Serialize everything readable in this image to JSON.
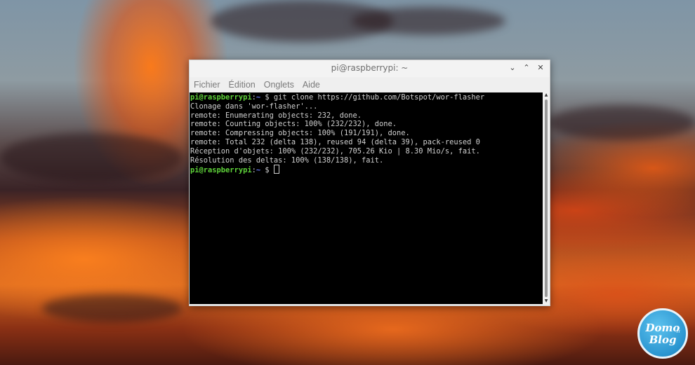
{
  "window": {
    "title": "pi@raspberrypi: ~",
    "controls": {
      "minimize": "⌄",
      "maximize": "⌃",
      "close": "✕"
    }
  },
  "menubar": {
    "items": [
      "Fichier",
      "Édition",
      "Onglets",
      "Aide"
    ]
  },
  "terminal": {
    "prompt_user": "pi@raspberrypi",
    "prompt_sep": ":",
    "prompt_path": "~",
    "prompt_symbol": " $ ",
    "command": "git clone https://github.com/Botspot/wor-flasher",
    "output": [
      "Clonage dans 'wor-flasher'...",
      "remote: Enumerating objects: 232, done.",
      "remote: Counting objects: 100% (232/232), done.",
      "remote: Compressing objects: 100% (191/191), done.",
      "remote: Total 232 (delta 138), reused 94 (delta 39), pack-reused 0",
      "Réception d'objets: 100% (232/232), 705.26 Kio | 8.30 Mio/s, fait.",
      "Résolution des deltas: 100% (138/138), fait."
    ],
    "colors": {
      "background": "#000000",
      "text": "#d0d0d0",
      "user": "#5fd33a",
      "path": "#6a7dff"
    }
  },
  "logo": {
    "line1": "Domo",
    "line2": "Blog",
    "suffix": ".fr"
  }
}
